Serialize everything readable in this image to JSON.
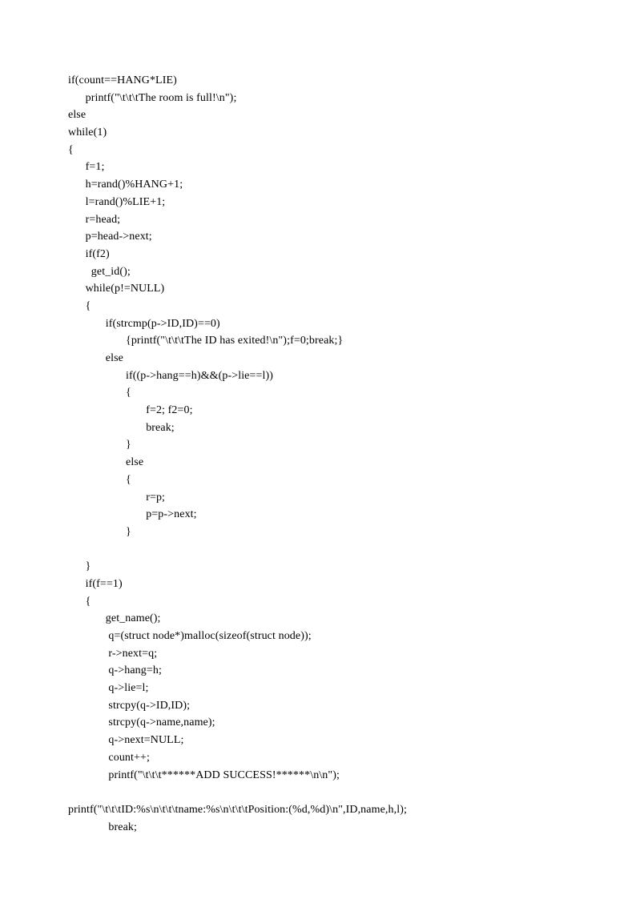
{
  "code": {
    "lines": [
      "if(count==HANG*LIE)",
      "      printf(\"\\t\\t\\tThe room is full!\\n\");",
      "else",
      "while(1)",
      "{",
      "      f=1;",
      "      h=rand()%HANG+1;",
      "      l=rand()%LIE+1;",
      "      r=head;",
      "      p=head->next;",
      "      if(f2)",
      "        get_id();",
      "      while(p!=NULL)",
      "      {",
      "             if(strcmp(p->ID,ID)==0)",
      "                    {printf(\"\\t\\t\\tThe ID has exited!\\n\");f=0;break;}",
      "             else",
      "                    if((p->hang==h)&&(p->lie==l))",
      "                    {",
      "                           f=2; f2=0;",
      "                           break;",
      "                    }",
      "                    else",
      "                    {",
      "                           r=p;",
      "                           p=p->next;",
      "                    }",
      "",
      "      }",
      "      if(f==1)",
      "      {",
      "             get_name();",
      "              q=(struct node*)malloc(sizeof(struct node));",
      "              r->next=q;",
      "              q->hang=h;",
      "              q->lie=l;",
      "              strcpy(q->ID,ID);",
      "              strcpy(q->name,name);",
      "              q->next=NULL;",
      "              count++;",
      "              printf(\"\\t\\t\\t******ADD SUCCESS!******\\n\\n\");",
      "",
      "printf(\"\\t\\t\\tID:%s\\n\\t\\t\\tname:%s\\n\\t\\t\\tPosition:(%d,%d)\\n\",ID,name,h,l);",
      "              break;"
    ]
  }
}
